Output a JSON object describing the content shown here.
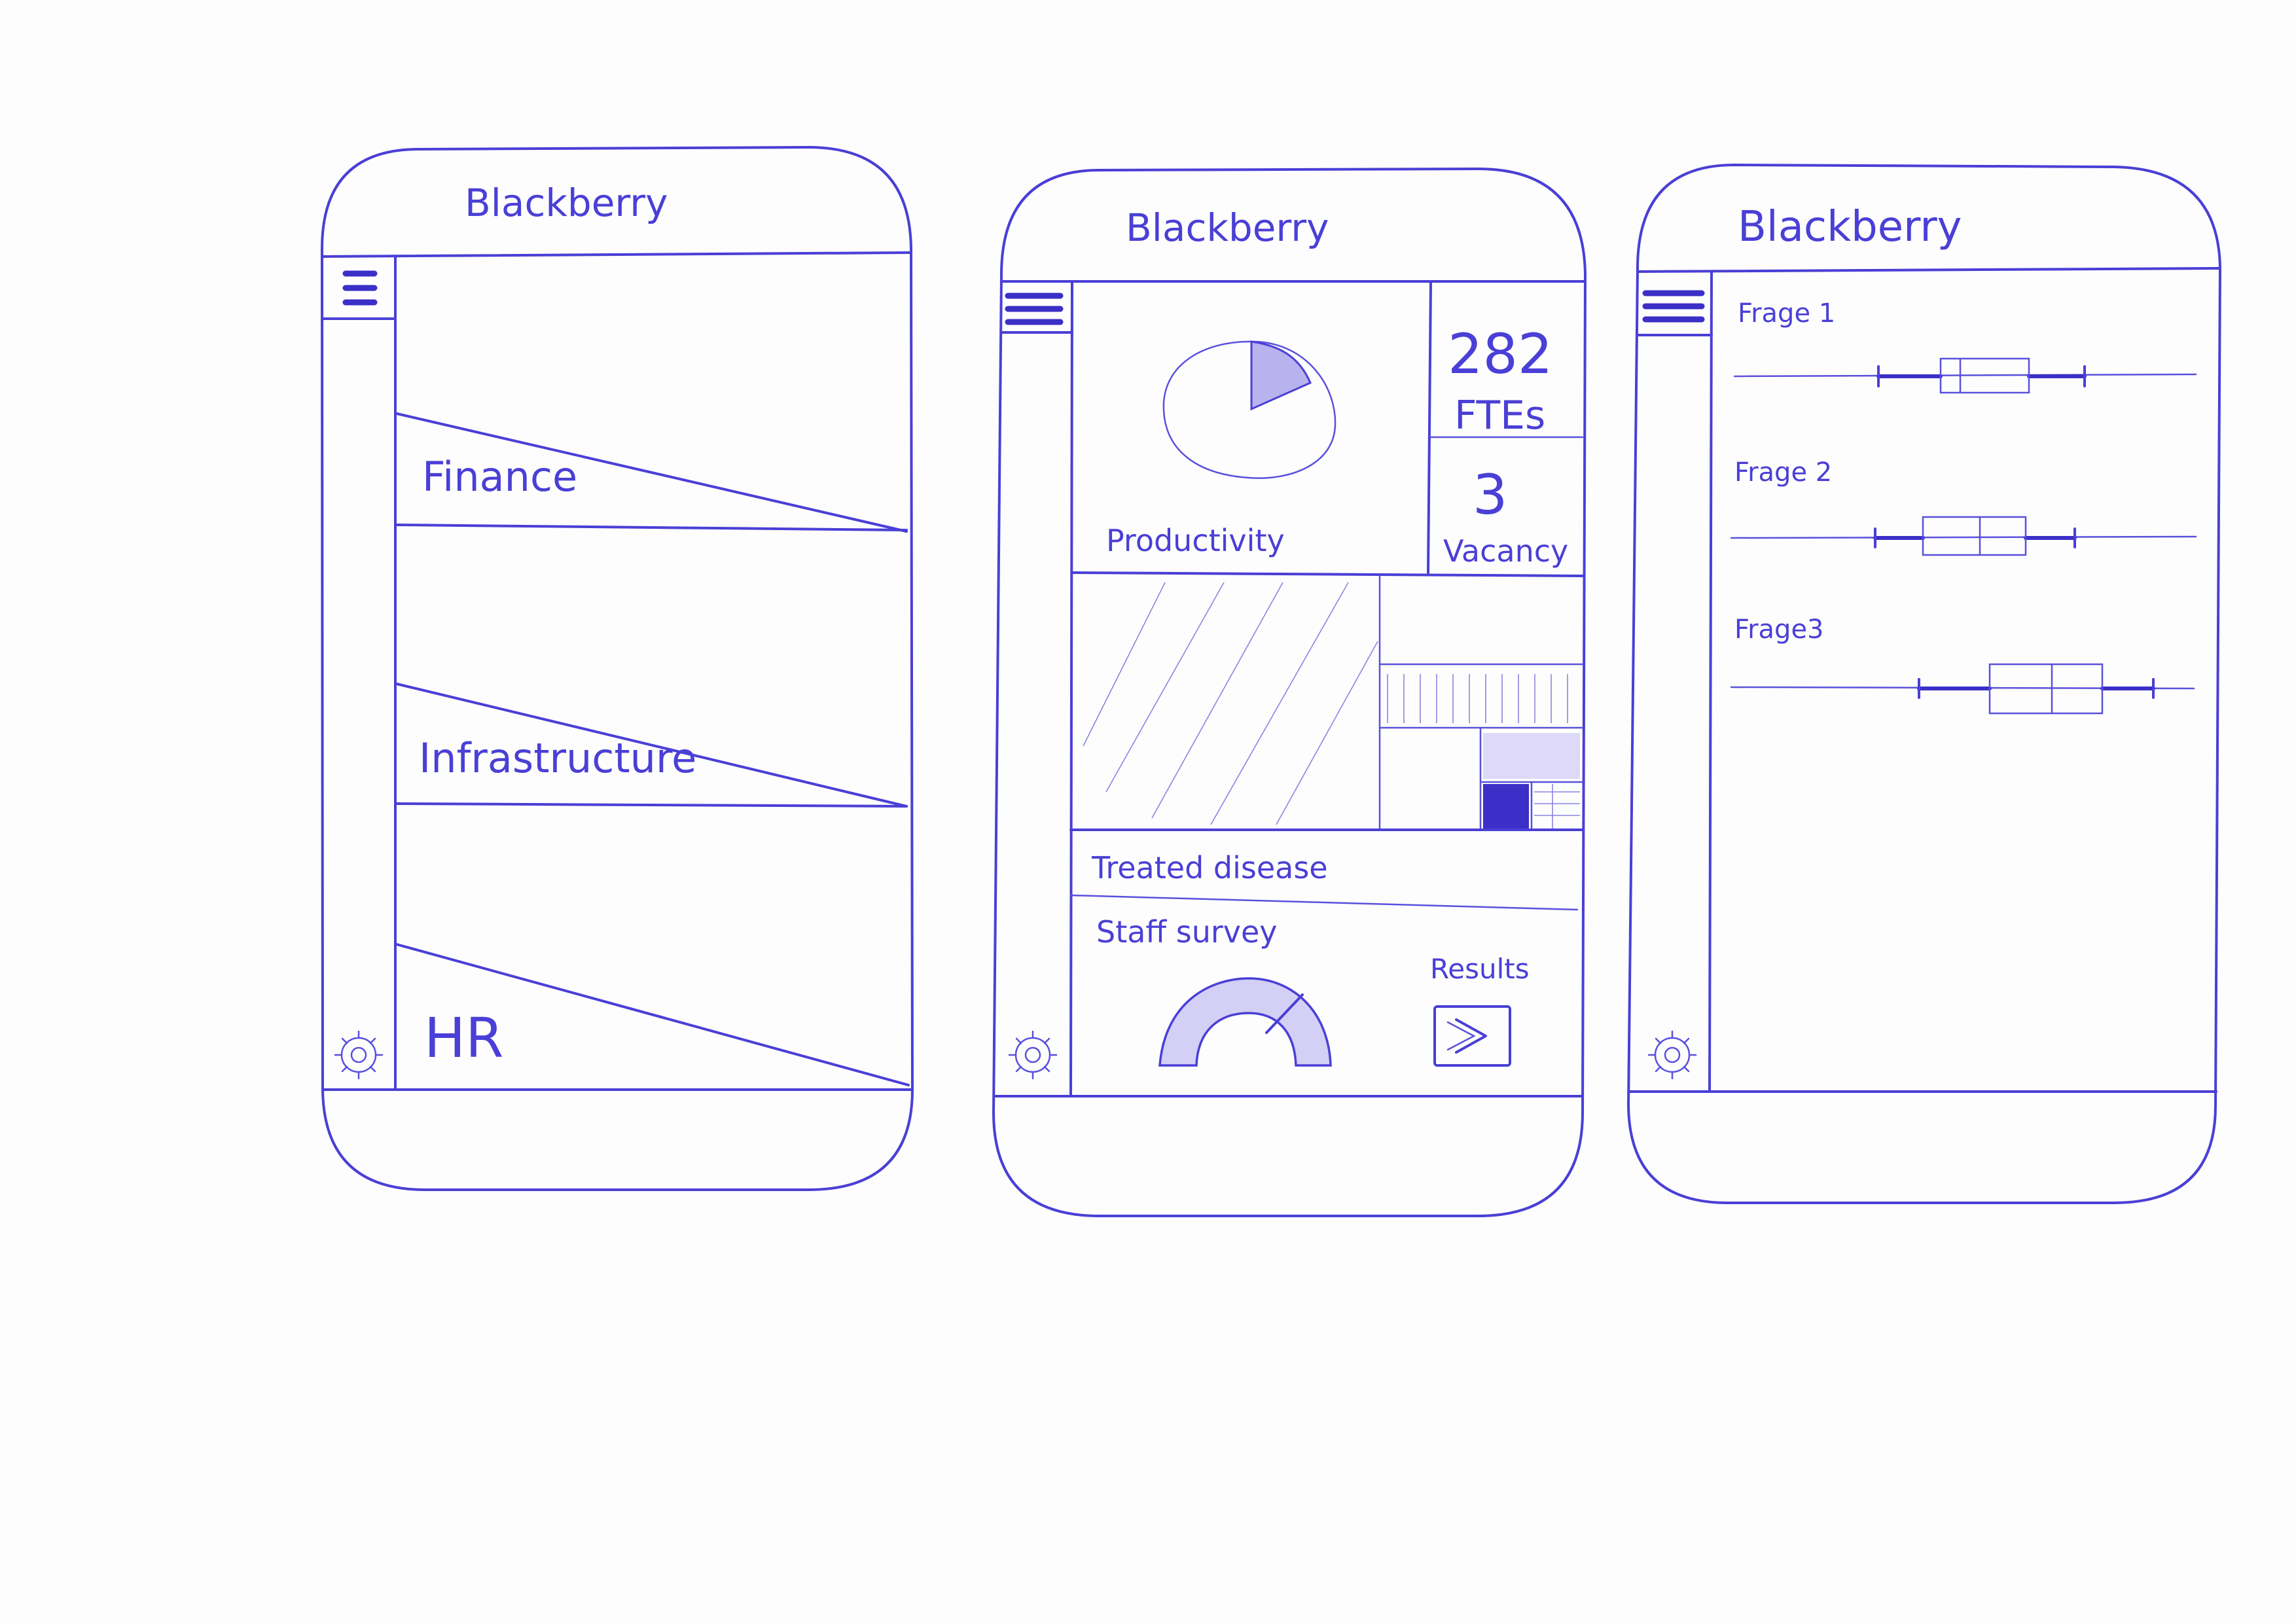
{
  "screens": [
    {
      "title": "Blackberry",
      "menu": [
        {
          "label": "Finance"
        },
        {
          "label": "Infrastructure"
        },
        {
          "label": "HR"
        }
      ]
    },
    {
      "title": "Blackberry",
      "widgets": {
        "productivity_label": "Productivity",
        "fte_value": "282",
        "fte_label": "FTEs",
        "vacancy_value": "3",
        "vacancy_label": "Vacancy",
        "treated_label": "Treated disease",
        "survey_label": "Staff survey",
        "results_label": "Results",
        "productivity_share": 0.12,
        "survey_gauge_level": 0.7
      }
    },
    {
      "title": "Blackberry",
      "questions": [
        {
          "label": "Frage 1"
        },
        {
          "label": "Frage 2"
        },
        {
          "label": "Frage3"
        }
      ]
    }
  ],
  "icons": [
    "hamburger-menu-icon",
    "gear-icon",
    "chevron-right-icon"
  ],
  "colors": {
    "ink": "#4a3fd6",
    "paper": "#fdfdfd"
  }
}
